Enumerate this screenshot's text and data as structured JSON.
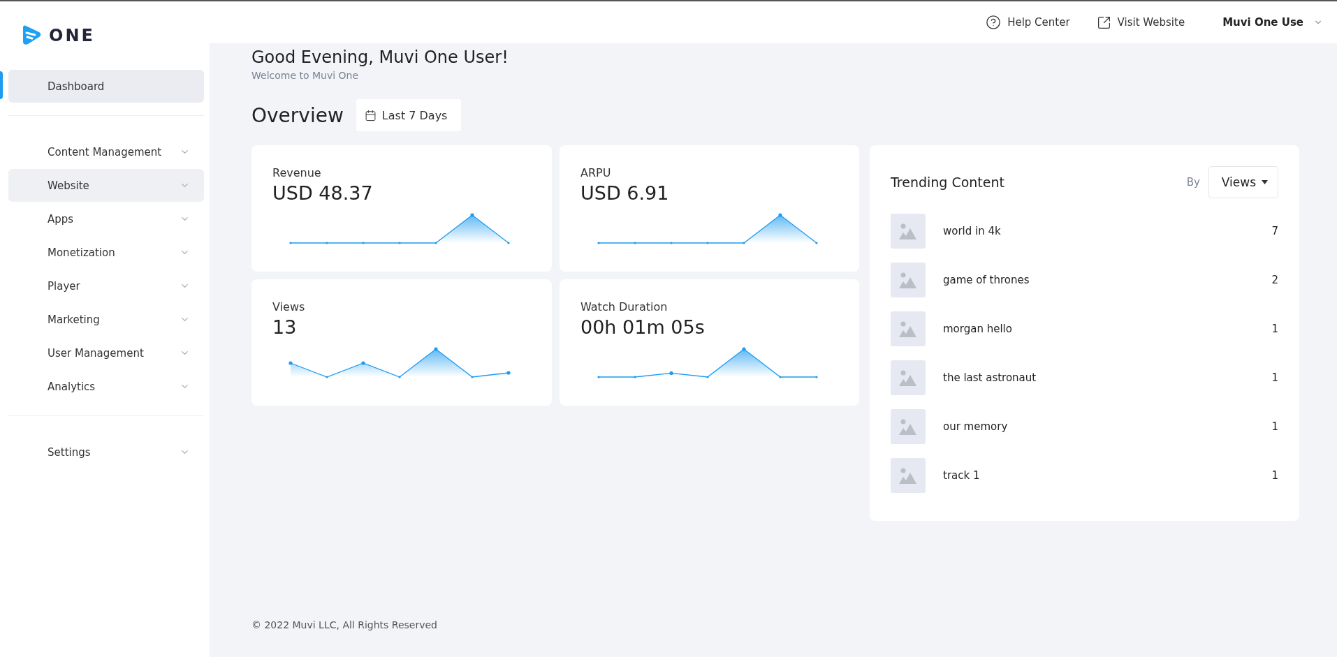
{
  "logo": {
    "text": "ONE"
  },
  "header": {
    "links": [
      {
        "kind": "help",
        "label": "Help Center"
      },
      {
        "kind": "external",
        "label": "Visit Website"
      }
    ],
    "user": {
      "name": "Muvi One Use"
    }
  },
  "sidebar": {
    "groups": [
      [
        {
          "label": "Dashboard",
          "selected": true,
          "hovered": false,
          "expandable": false
        }
      ],
      [
        {
          "label": "Content Management",
          "selected": false,
          "hovered": false,
          "expandable": true
        },
        {
          "label": "Website",
          "selected": false,
          "hovered": true,
          "expandable": true
        },
        {
          "label": "Apps",
          "selected": false,
          "hovered": false,
          "expandable": true
        },
        {
          "label": "Monetization",
          "selected": false,
          "hovered": false,
          "expandable": true
        },
        {
          "label": "Player",
          "selected": false,
          "hovered": false,
          "expandable": true
        },
        {
          "label": "Marketing",
          "selected": false,
          "hovered": false,
          "expandable": true
        },
        {
          "label": "User Management",
          "selected": false,
          "hovered": false,
          "expandable": true
        },
        {
          "label": "Analytics",
          "selected": false,
          "hovered": false,
          "expandable": true
        }
      ],
      [
        {
          "label": "Settings",
          "selected": false,
          "hovered": false,
          "expandable": true
        }
      ]
    ]
  },
  "greeting": {
    "title": "Good Evening, Muvi One User!",
    "subtitle": "Welcome to Muvi One"
  },
  "overview": {
    "title": "Overview",
    "range": "Last 7 Days"
  },
  "stats": [
    {
      "label": "Revenue",
      "value": "USD 48.37"
    },
    {
      "label": "ARPU",
      "value": "USD 6.91"
    },
    {
      "label": "Views",
      "value": "13"
    },
    {
      "label": "Watch Duration",
      "value": "00h 01m 05s"
    }
  ],
  "trending": {
    "title": "Trending Content",
    "by_label": "By",
    "sort": "Views",
    "items": [
      {
        "name": "world in 4k",
        "count": "7"
      },
      {
        "name": "game of thrones",
        "count": "2"
      },
      {
        "name": "morgan hello",
        "count": "1"
      },
      {
        "name": "the last astronaut",
        "count": "1"
      },
      {
        "name": "our memory",
        "count": "1"
      },
      {
        "name": "track 1",
        "count": "1"
      }
    ]
  },
  "footer": {
    "text": "© 2022 Muvi LLC, All Rights Reserved"
  }
}
